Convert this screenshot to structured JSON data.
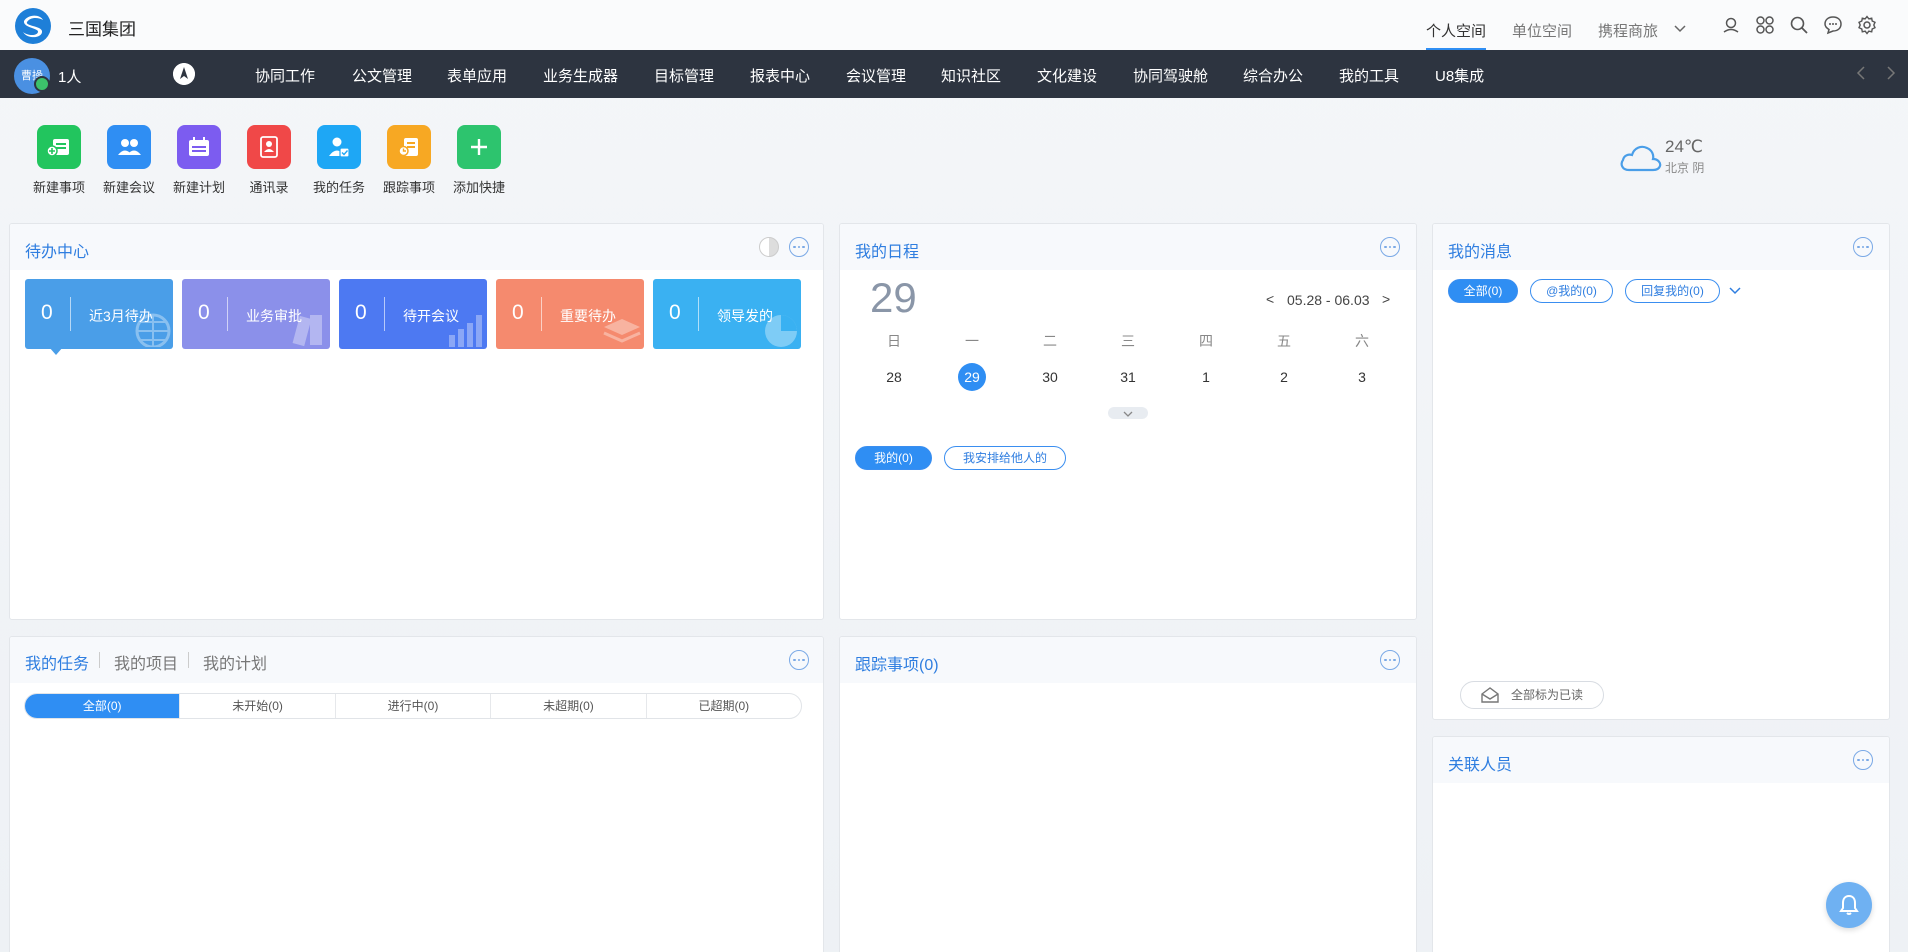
{
  "header": {
    "company": "三国集团",
    "spaces": [
      "个人空间",
      "单位空间",
      "携程商旅"
    ]
  },
  "nav": {
    "avatar_text": "曹操",
    "people_count": "1人",
    "items": [
      "协同工作",
      "公文管理",
      "表单应用",
      "业务生成器",
      "目标管理",
      "报表中心",
      "会议管理",
      "知识社区",
      "文化建设",
      "协同驾驶舱",
      "综合办公",
      "我的工具",
      "U8集成"
    ]
  },
  "quick_actions": [
    {
      "label": "新建事项",
      "color": "#22c55e",
      "icon": "new-item-icon"
    },
    {
      "label": "新建会议",
      "color": "#2f8ef3",
      "icon": "meeting-icon"
    },
    {
      "label": "新建计划",
      "color": "#7c5cf0",
      "icon": "plan-icon"
    },
    {
      "label": "通讯录",
      "color": "#f04848",
      "icon": "contacts-icon"
    },
    {
      "label": "我的任务",
      "color": "#1ea7f5",
      "icon": "task-icon"
    },
    {
      "label": "跟踪事项",
      "color": "#f7a823",
      "icon": "track-icon"
    },
    {
      "label": "添加快捷",
      "color": "#2dc46e",
      "icon": "plus-icon"
    }
  ],
  "weather": {
    "temp": "24℃",
    "location": "北京 阴"
  },
  "todo": {
    "title": "待办中心",
    "cards": [
      {
        "count": "0",
        "label": "近3月待办",
        "color": "#4a9ee8"
      },
      {
        "count": "0",
        "label": "业务审批",
        "color": "#8b90ea"
      },
      {
        "count": "0",
        "label": "待开会议",
        "color": "#4d79f2"
      },
      {
        "count": "0",
        "label": "重要待办",
        "color": "#f58a6e"
      },
      {
        "count": "0",
        "label": "领导发的",
        "color": "#3ab1f2"
      }
    ]
  },
  "schedule": {
    "title": "我的日程",
    "day": "29",
    "range": "05.28 - 06.03",
    "prev": "<",
    "next": ">",
    "weekdays": [
      "日",
      "一",
      "二",
      "三",
      "四",
      "五",
      "六"
    ],
    "dates": [
      "28",
      "29",
      "30",
      "31",
      "1",
      "2",
      "3"
    ],
    "pill_mine": "我的(0)",
    "pill_assigned": "我安排给他人的"
  },
  "messages": {
    "title": "我的消息",
    "pills": [
      "全部(0)",
      "@我的(0)",
      "回复我的(0)"
    ],
    "mark_all_read": "全部标为已读"
  },
  "tasks": {
    "tabs": [
      "我的任务",
      "我的项目",
      "我的计划"
    ],
    "filters": [
      "全部(0)",
      "未开始(0)",
      "进行中(0)",
      "未超期(0)",
      "已超期(0)"
    ]
  },
  "tracking": {
    "title": "跟踪事项(0)"
  },
  "related": {
    "title": "关联人员"
  }
}
